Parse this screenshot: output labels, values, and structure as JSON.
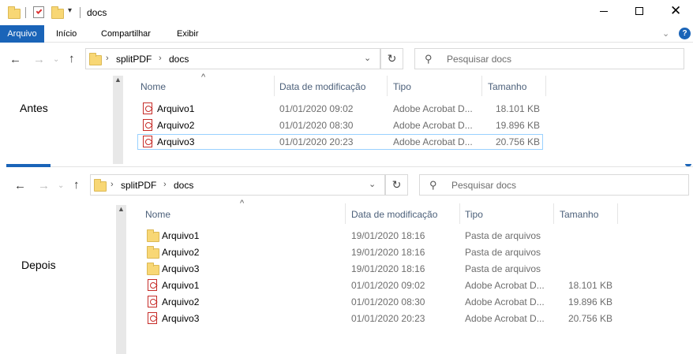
{
  "window": {
    "title": "docs"
  },
  "ribbon": {
    "tabs": [
      "Arquivo",
      "Início",
      "Compartilhar",
      "Exibir"
    ]
  },
  "top": {
    "breadcrumb": [
      "splitPDF",
      "docs"
    ],
    "search_placeholder": "Pesquisar docs",
    "columns": [
      "Nome",
      "Data de modificação",
      "Tipo",
      "Tamanho"
    ],
    "label": "Antes",
    "rows": [
      {
        "name": "Arquivo1",
        "date": "01/01/2020 09:02",
        "type": "Adobe Acrobat D...",
        "size": "18.101 KB",
        "icon": "pdf-icon"
      },
      {
        "name": "Arquivo2",
        "date": "01/01/2020 08:30",
        "type": "Adobe Acrobat D...",
        "size": "19.896 KB",
        "icon": "pdf-icon"
      },
      {
        "name": "Arquivo3",
        "date": "01/01/2020 20:23",
        "type": "Adobe Acrobat D...",
        "size": "20.756 KB",
        "icon": "pdf-icon",
        "selected": true
      }
    ]
  },
  "bottom": {
    "breadcrumb": [
      "splitPDF",
      "docs"
    ],
    "search_placeholder": "Pesquisar docs",
    "columns": [
      "Nome",
      "Data de modificação",
      "Tipo",
      "Tamanho"
    ],
    "label": "Depois",
    "rows": [
      {
        "name": "Arquivo1",
        "date": "19/01/2020 18:16",
        "type": "Pasta de arquivos",
        "size": "",
        "icon": "folder-icon"
      },
      {
        "name": "Arquivo2",
        "date": "19/01/2020 18:16",
        "type": "Pasta de arquivos",
        "size": "",
        "icon": "folder-icon"
      },
      {
        "name": "Arquivo3",
        "date": "19/01/2020 18:16",
        "type": "Pasta de arquivos",
        "size": "",
        "icon": "folder-icon"
      },
      {
        "name": "Arquivo1",
        "date": "01/01/2020 09:02",
        "type": "Adobe Acrobat D...",
        "size": "18.101 KB",
        "icon": "pdf-icon"
      },
      {
        "name": "Arquivo2",
        "date": "01/01/2020 08:30",
        "type": "Adobe Acrobat D...",
        "size": "19.896 KB",
        "icon": "pdf-icon"
      },
      {
        "name": "Arquivo3",
        "date": "01/01/2020 20:23",
        "type": "Adobe Acrobat D...",
        "size": "20.756 KB",
        "icon": "pdf-icon"
      }
    ]
  },
  "colors": {
    "accent": "#1a64b8",
    "selection_border": "#99d1ff",
    "header_text": "#4c607a"
  }
}
